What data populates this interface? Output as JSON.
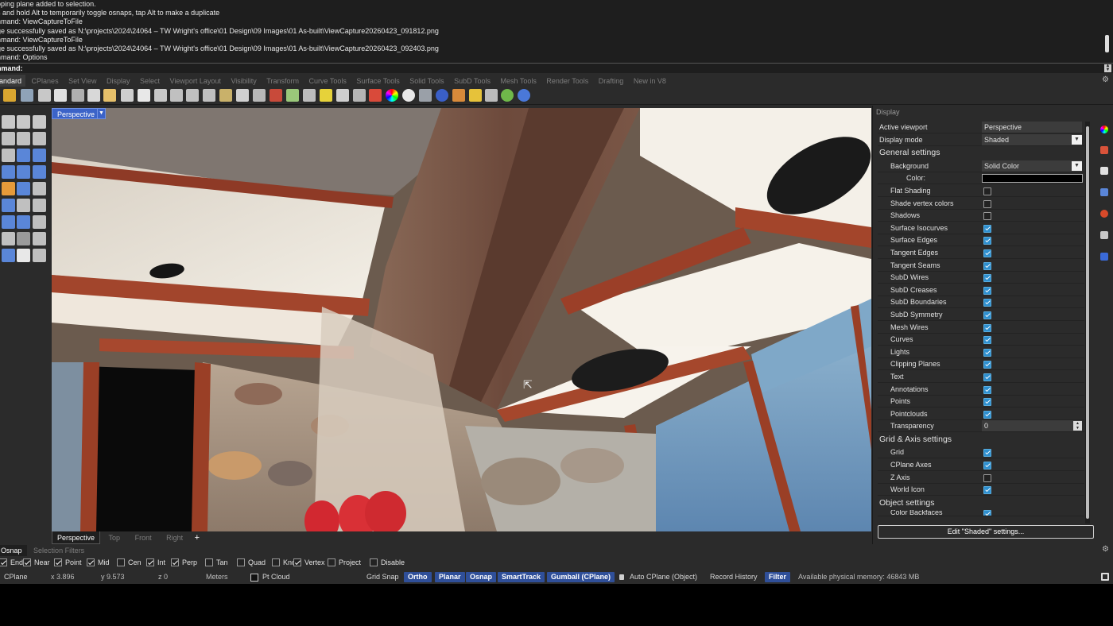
{
  "history": {
    "lines": [
      "pping plane added to selection.",
      "s and hold Alt to temporarily toggle osnaps, tap Alt to make a duplicate",
      "nmand: ViewCaptureToFile",
      "ge successfully saved as N:\\projects\\2024\\24064 – TW Wright's office\\01 Design\\09 Images\\01 As-built\\ViewCapture20260423_091812.png",
      "nmand: ViewCaptureToFile",
      "ge successfully saved as N:\\projects\\2024\\24064 – TW Wright's office\\01 Design\\09 Images\\01 As-built\\ViewCapture20260423_092403.png",
      "nmand: Options"
    ]
  },
  "command": {
    "prompt": "nmand:"
  },
  "tabs": [
    "andard",
    "CPlanes",
    "Set View",
    "Display",
    "Select",
    "Viewport Layout",
    "Visibility",
    "Transform",
    "Curve Tools",
    "Surface Tools",
    "Solid Tools",
    "SubD Tools",
    "Mesh Tools",
    "Render Tools",
    "Drafting",
    "New in V8"
  ],
  "viewport": {
    "label": "Perspective"
  },
  "viewport_tabs": [
    "Perspective",
    "Top",
    "Front",
    "Right"
  ],
  "panel": {
    "title": "Display",
    "active_viewport_label": "Active viewport",
    "active_viewport_value": "Perspective",
    "display_mode_label": "Display mode",
    "display_mode_value": "Shaded",
    "general_settings": "General settings",
    "background_label": "Background",
    "background_value": "Solid Color",
    "color_label": "Color:",
    "background_color": "#000000",
    "general_checks": [
      {
        "label": "Flat Shading",
        "checked": false
      },
      {
        "label": "Shade vertex colors",
        "checked": false
      },
      {
        "label": "Shadows",
        "checked": false
      },
      {
        "label": "Surface Isocurves",
        "checked": true
      },
      {
        "label": "Surface Edges",
        "checked": true
      },
      {
        "label": "Tangent Edges",
        "checked": true
      },
      {
        "label": "Tangent Seams",
        "checked": true
      },
      {
        "label": "SubD Wires",
        "checked": true
      },
      {
        "label": "SubD Creases",
        "checked": true
      },
      {
        "label": "SubD Boundaries",
        "checked": true
      },
      {
        "label": "SubD Symmetry",
        "checked": true
      },
      {
        "label": "Mesh Wires",
        "checked": true
      },
      {
        "label": "Curves",
        "checked": true
      },
      {
        "label": "Lights",
        "checked": true
      },
      {
        "label": "Clipping Planes",
        "checked": true
      },
      {
        "label": "Text",
        "checked": true
      },
      {
        "label": "Annotations",
        "checked": true
      },
      {
        "label": "Points",
        "checked": true
      },
      {
        "label": "Pointclouds",
        "checked": true
      }
    ],
    "transparency_label": "Transparency",
    "transparency_value": "0",
    "grid_axis_settings": "Grid & Axis settings",
    "grid_checks": [
      {
        "label": "Grid",
        "checked": true
      },
      {
        "label": "CPlane Axes",
        "checked": true
      },
      {
        "label": "Z Axis",
        "checked": false
      },
      {
        "label": "World Icon",
        "checked": true
      }
    ],
    "object_settings": "Object settings",
    "object_checks": [
      {
        "label": "Color Backfaces",
        "checked": true
      }
    ],
    "edit_button": "Edit \"Shaded\" settings..."
  },
  "osnap_tabs": [
    "Osnap",
    "Selection Filters"
  ],
  "osnaps": [
    {
      "label": "End",
      "checked": true
    },
    {
      "label": "Near",
      "checked": true
    },
    {
      "label": "Point",
      "checked": true
    },
    {
      "label": "Mid",
      "checked": true
    },
    {
      "label": "Cen",
      "checked": false
    },
    {
      "label": "Int",
      "checked": true
    },
    {
      "label": "Perp",
      "checked": true
    },
    {
      "label": "Tan",
      "checked": false
    },
    {
      "label": "Quad",
      "checked": false
    },
    {
      "label": "Knot",
      "checked": false
    },
    {
      "label": "Vertex",
      "checked": true
    },
    {
      "label": "Project",
      "checked": false
    },
    {
      "label": "Disable",
      "checked": false
    }
  ],
  "status": {
    "cplane": "CPlane",
    "x": "x 3.896",
    "y": "y 9.573",
    "z": "z 0",
    "units": "Meters",
    "pt_cloud": "Pt Cloud",
    "grid_snap": "Grid Snap",
    "ortho": "Ortho",
    "planar": "Planar",
    "osnap": "Osnap",
    "smarttrack": "SmartTrack",
    "gumball": "Gumball (CPlane)",
    "auto_cplane": "Auto CPlane (Object)",
    "record_history": "Record History",
    "filter": "Filter",
    "memory": "Available physical memory: 46843 MB"
  }
}
